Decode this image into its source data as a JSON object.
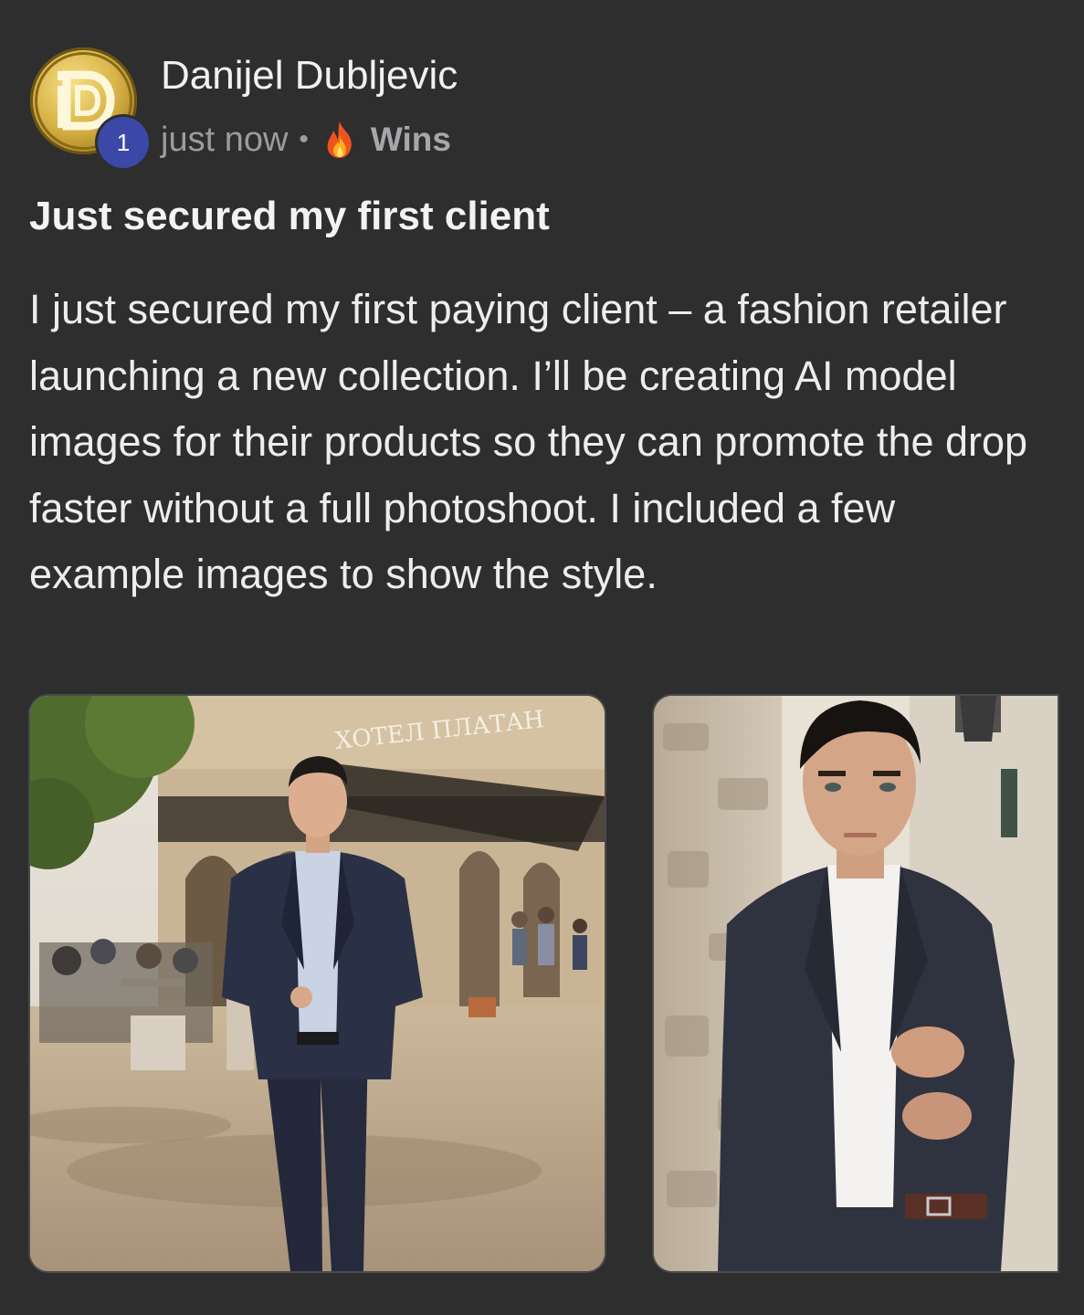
{
  "post": {
    "author": {
      "name": "Danijel Dubljevic",
      "avatar_icon": "gold-coin-d-logo-icon",
      "level": "1"
    },
    "meta": {
      "timestamp": "just now",
      "separator": "•",
      "category_icon": "fire-icon",
      "category": "Wins"
    },
    "title": "Just secured my first client",
    "body": "I just secured my first paying client – a fashion retailer launching a new collection. I’ll be creating AI model images for their products so they can promote the drop faster without a full photoshoot. I included a few example images to show the style.",
    "images": [
      {
        "sign_text": "ХОТЕЛ ПЛАТАН"
      },
      {
        "sign_text": ""
      }
    ]
  },
  "colors": {
    "background": "#2e2e2f",
    "text_primary": "#ededee",
    "text_secondary": "#9c9ca0",
    "level_badge": "#3c48a8",
    "avatar_gold": "#d9b54a"
  }
}
